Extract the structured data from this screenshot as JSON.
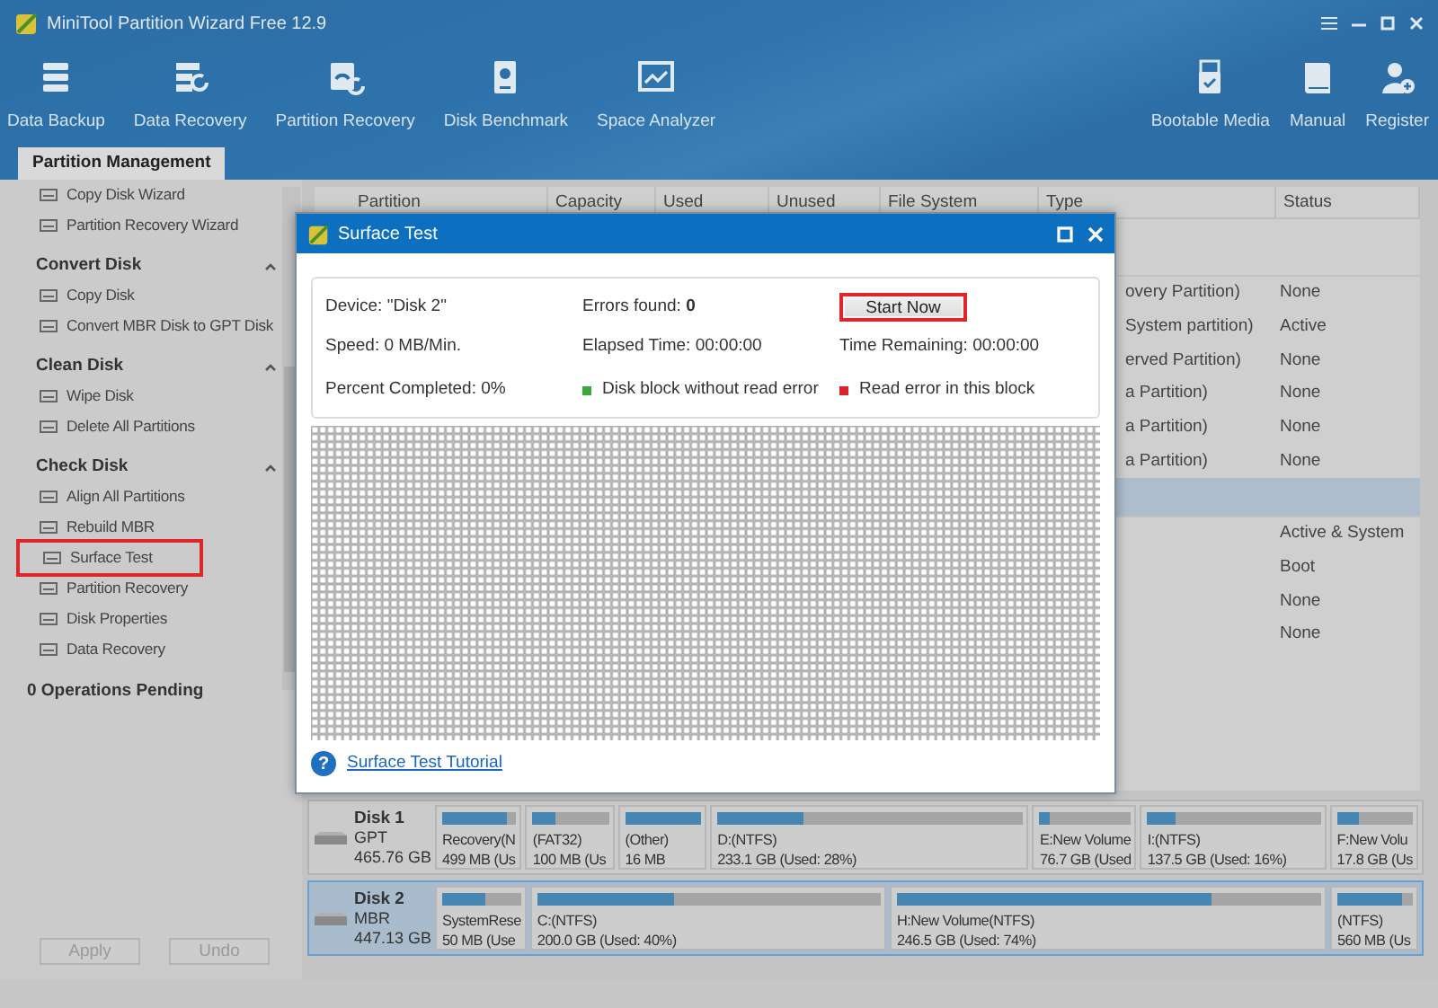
{
  "window": {
    "title": "MiniTool Partition Wizard Free 12.9"
  },
  "toolbar": {
    "left": [
      {
        "label": "Data Backup"
      },
      {
        "label": "Data Recovery"
      },
      {
        "label": "Partition Recovery"
      },
      {
        "label": "Disk Benchmark"
      },
      {
        "label": "Space Analyzer"
      }
    ],
    "right": [
      {
        "label": "Bootable Media"
      },
      {
        "label": "Manual"
      },
      {
        "label": "Register"
      }
    ]
  },
  "tabs": [
    {
      "label": "Partition Management",
      "selected": true
    }
  ],
  "sidebar": {
    "sections": [
      {
        "items": [
          {
            "label": "Copy Disk Wizard",
            "highlighted": false
          },
          {
            "label": "Partition Recovery Wizard",
            "highlighted": false
          }
        ]
      },
      {
        "title": "Convert Disk",
        "expanded": true,
        "items": [
          {
            "label": "Copy Disk",
            "highlighted": false
          },
          {
            "label": "Convert MBR Disk to GPT Disk",
            "highlighted": false
          }
        ]
      },
      {
        "title": "Clean Disk",
        "expanded": true,
        "items": [
          {
            "label": "Wipe Disk",
            "highlighted": false
          },
          {
            "label": "Delete All Partitions",
            "highlighted": false
          }
        ]
      },
      {
        "title": "Check Disk",
        "expanded": true,
        "items": [
          {
            "label": "Align All Partitions",
            "highlighted": false
          },
          {
            "label": "Rebuild MBR",
            "highlighted": false
          },
          {
            "label": "Surface Test",
            "highlighted": true
          },
          {
            "label": "Partition Recovery",
            "highlighted": false
          },
          {
            "label": "Disk Properties",
            "highlighted": false
          },
          {
            "label": "Data Recovery",
            "highlighted": false
          }
        ]
      }
    ],
    "pending": "0 Operations Pending",
    "buttons": [
      {
        "label": "Apply",
        "disabled": true
      },
      {
        "label": "Undo",
        "disabled": true
      }
    ]
  },
  "table": {
    "columns": [
      "Partition",
      "Capacity",
      "Used",
      "Unused",
      "File System",
      "Type",
      "Status"
    ],
    "rows": [
      {
        "kind": "disk",
        "selected": false
      },
      {
        "kind": "partition",
        "type": "overy Partition)",
        "status": "None"
      },
      {
        "kind": "partition",
        "type": "System partition)",
        "status": "Active"
      },
      {
        "kind": "partition",
        "type": "erved Partition)",
        "status": "None"
      },
      {
        "kind": "partition",
        "type": "a Partition)",
        "status": "None"
      },
      {
        "kind": "partition",
        "type": "a Partition)",
        "status": "None"
      },
      {
        "kind": "partition",
        "type": "a Partition)",
        "status": "None"
      },
      {
        "kind": "disk",
        "selected": true
      },
      {
        "kind": "partition",
        "status": "Active & System"
      },
      {
        "kind": "partition",
        "status": "Boot"
      },
      {
        "kind": "partition",
        "status": "None"
      },
      {
        "kind": "partition",
        "status": "None"
      }
    ]
  },
  "dialog": {
    "title": "Surface Test",
    "fields": [
      "Device:  \"Disk 2\"",
      "Errors found:  **0**",
      "Speed:  0 MB/Min.",
      "Elapsed Time:  00:00:00",
      "Time Remaining:  00:00:00",
      "Percent Completed:  0%"
    ],
    "start_button": {
      "label": "Start Now",
      "highlighted": true
    },
    "legend": [
      {
        "label": "Disk block without read error",
        "color": "#3aa83a"
      },
      {
        "label": "Read error in this block",
        "color": "#d8232a"
      }
    ],
    "link": {
      "icon": "?",
      "label": "Surface Test Tutorial"
    }
  },
  "disk_map": [
    {
      "name": "Disk 1",
      "scheme": "GPT",
      "size": "465.76 GB",
      "selected": false,
      "partitions": [
        {
          "label": "Recovery(N",
          "detail": "499 MB (Us",
          "level": 0.88
        },
        {
          "label": "(FAT32)",
          "detail": "100 MB (Us",
          "level": 0.3
        },
        {
          "label": "(Other)",
          "detail": "16 MB",
          "level": 1
        },
        {
          "label": "D:(NTFS)",
          "detail": "233.1 GB (Used: 28%)",
          "level": 0.28
        },
        {
          "label": "E:New Volume",
          "detail": "76.7 GB (Used",
          "level": 0.1
        },
        {
          "label": "I:(NTFS)",
          "detail": "137.5 GB (Used: 16%)",
          "level": 0.16
        },
        {
          "label": "F:New Volu",
          "detail": "17.8 GB (Us",
          "level": 0.28
        }
      ]
    },
    {
      "name": "Disk 2",
      "scheme": "MBR",
      "size": "447.13 GB",
      "selected": true,
      "partitions": [
        {
          "label": "SystemRese",
          "detail": "50 MB (Use",
          "level": 0.55
        },
        {
          "label": "C:(NTFS)",
          "detail": "200.0 GB (Used: 40%)",
          "level": 0.4
        },
        {
          "label": "H:New Volume(NTFS)",
          "detail": "246.5 GB (Used: 74%)",
          "level": 0.74
        },
        {
          "label": "(NTFS)",
          "detail": "560 MB (Us",
          "level": 0.85
        }
      ]
    }
  ]
}
